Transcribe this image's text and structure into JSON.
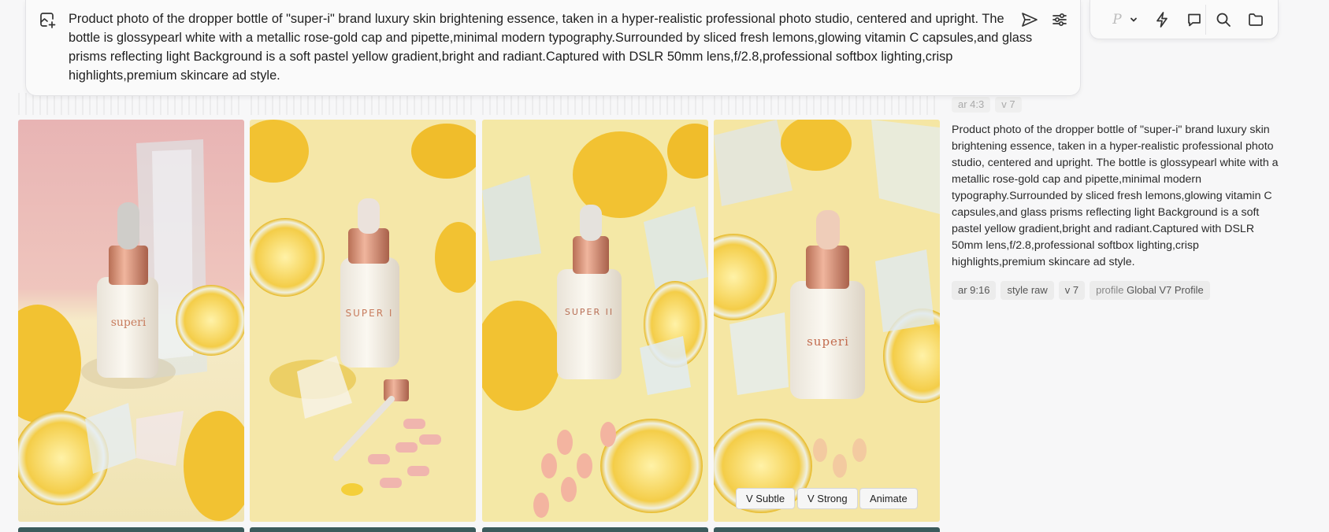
{
  "prompt": {
    "text": "Product photo of the dropper bottle of \"super-i\" brand luxury skin brightening essence, taken in a hyper-realistic professional photo studio, centered and upright. The bottle is glossypearl white with a metallic rose-gold cap and pipette,minimal modern typography.Surrounded by sliced fresh lemons,glowing vitamin C capsules,and glass prisms reflecting light Background is a soft pastel yellow gradient,bright and radiant.Captured with DSLR 50mm lens,f/2.8,professional softbox lighting,crisp highlights,premium skincare ad style.",
    "icons": {
      "image_prompt": "image-add-icon",
      "send": "send-icon",
      "settings": "sliders-icon"
    }
  },
  "toolbar": {
    "profile_letter": "P",
    "icons": [
      "chevron-down-icon",
      "lightning-icon",
      "chat-icon",
      "search-icon",
      "folder-icon"
    ]
  },
  "previous_job": {
    "tags": [
      "ar 4:3",
      "v 7"
    ]
  },
  "job": {
    "description": "Product photo of the dropper bottle of \"super-i\" brand luxury skin brightening essence, taken in a hyper-realistic professional photo studio, centered and upright. The bottle is glossypearl white with a metallic rose-gold cap and pipette,minimal modern typography.Surrounded by sliced fresh lemons,glowing vitamin C capsules,and glass prisms reflecting light Background is a soft pastel yellow gradient,bright and radiant.Captured with DSLR 50mm lens,f/2.8,professional softbox lighting,crisp highlights,premium skincare ad style.",
    "tags": {
      "ar": "ar 9:16",
      "style": "style raw",
      "version": "v 7",
      "profile_key": "profile",
      "profile_value": "Global V7 Profile"
    },
    "images": [
      {
        "brand_label": "superi",
        "background": "pink wall with glass prism"
      },
      {
        "brand_label": "SUPER I",
        "background": "yellow with lemons and capsules"
      },
      {
        "brand_label": "SUPER II",
        "background": "yellow with crystals and lemons"
      },
      {
        "brand_label": "superi",
        "background": "yellow with crystals and lemons"
      }
    ],
    "hover_actions": [
      "V Subtle",
      "V Strong",
      "Animate"
    ]
  },
  "colors": {
    "accent_rose_gold": "#d59a83",
    "lemon": "#f2c232",
    "bg_yellow": "#f6ebb4"
  }
}
